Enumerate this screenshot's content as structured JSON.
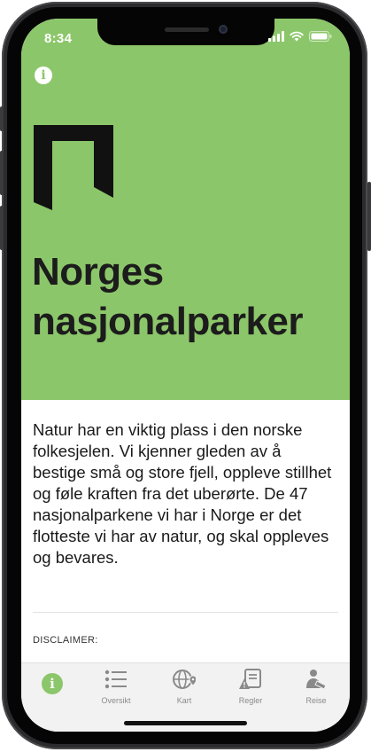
{
  "status_bar": {
    "time": "8:34"
  },
  "hero": {
    "title_line1": "Norges",
    "title_line2": "nasjonalparker",
    "background": "#8cc66a"
  },
  "content": {
    "intro": "Natur har en viktig plass i den norske folkesjelen. Vi kjenner gleden av å bestige små og store fjell, oppleve stillhet og føle kraften fra det uberørte. De 47 nasjonalparkene vi har i Norge er det flotteste vi har av natur, og skal oppleves og bevares.",
    "disclaimer_heading": "DISCLAIMER:"
  },
  "tabs": [
    {
      "label": "",
      "icon": "info-icon",
      "active": true
    },
    {
      "label": "Oversikt",
      "icon": "list-icon",
      "active": false
    },
    {
      "label": "Kart",
      "icon": "globe-pin-icon",
      "active": false
    },
    {
      "label": "Regler",
      "icon": "rules-warning-icon",
      "active": false
    },
    {
      "label": "Reise",
      "icon": "traveler-icon",
      "active": false
    }
  ],
  "colors": {
    "accent": "#8cc66a",
    "tab_inactive": "#8a8a8a"
  }
}
